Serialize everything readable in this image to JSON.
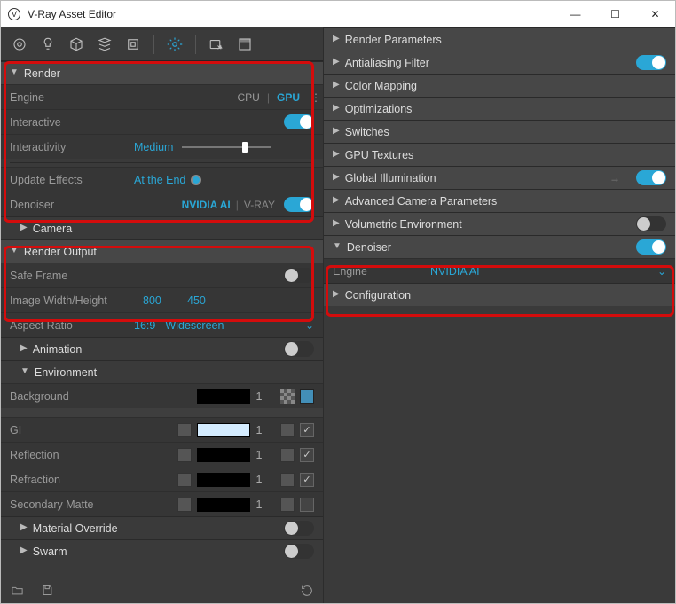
{
  "window": {
    "title": "V-Ray Asset Editor",
    "min": "—",
    "max": "☐",
    "close": "✕"
  },
  "left": {
    "render": {
      "title": "Render",
      "engine_lbl": "Engine",
      "cpu": "CPU",
      "gpu": "GPU",
      "interactive_lbl": "Interactive",
      "interactivity_lbl": "Interactivity",
      "interactivity_val": "Medium",
      "update_lbl": "Update Effects",
      "update_val": "At the End",
      "denoiser_lbl": "Denoiser",
      "denoiser_ai": "NVIDIA AI",
      "denoiser_vray": "V-RAY"
    },
    "camera": "Camera",
    "output": {
      "title": "Render Output",
      "safe_lbl": "Safe Frame",
      "imgwh_lbl": "Image Width/Height",
      "img_w": "800",
      "img_h": "450",
      "aspect_lbl": "Aspect Ratio",
      "aspect_val": "16:9 - Widescreen"
    },
    "animation": "Animation",
    "env": {
      "title": "Environment",
      "bg": "Background",
      "gi": "GI",
      "refl": "Reflection",
      "refr": "Refraction",
      "matte": "Secondary Matte",
      "mult1": "1"
    },
    "matov": "Material Override",
    "swarm": "Swarm"
  },
  "right": {
    "render_params": "Render Parameters",
    "aa": "Antialiasing Filter",
    "color_map": "Color Mapping",
    "optim": "Optimizations",
    "switches": "Switches",
    "gpu_tex": "GPU Textures",
    "gi": "Global Illumination",
    "advcam": "Advanced Camera Parameters",
    "volenv": "Volumetric Environment",
    "denoiser": "Denoiser",
    "engine_lbl": "Engine",
    "engine_val": "NVIDIA AI",
    "config": "Configuration"
  },
  "colors": {
    "accent": "#2aa7d6",
    "red": "#d40c0c"
  }
}
